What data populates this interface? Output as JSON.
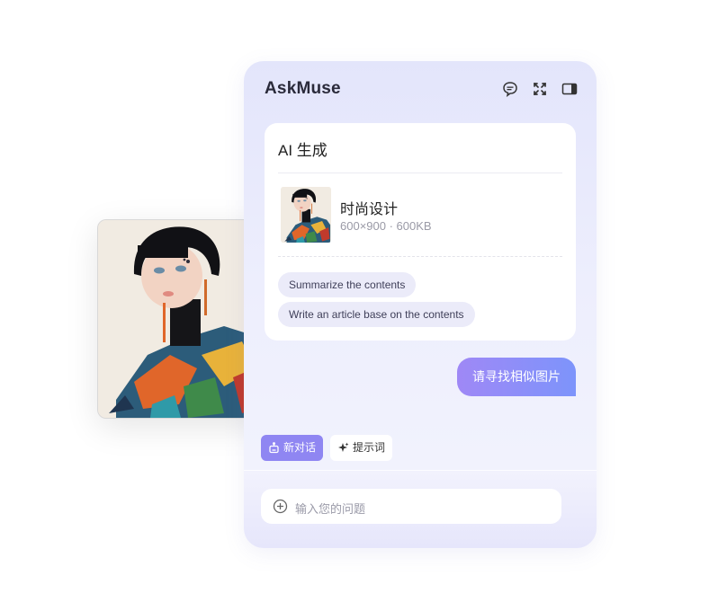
{
  "app": {
    "title": "AskMuse"
  },
  "header_icons": [
    "chat-bubble-icon",
    "fullscreen-icon",
    "sidebar-panel-icon"
  ],
  "card": {
    "title": "AI 生成",
    "file": {
      "name": "时尚设计",
      "meta": "600×900 · 600KB"
    },
    "suggestions": [
      "Summarize the contents",
      "Write an article base on the contents"
    ]
  },
  "chat": {
    "user_message": "请寻找相似图片"
  },
  "toolbar": {
    "new_chat": "新对话",
    "prompts": "提示词"
  },
  "input": {
    "placeholder": "输入您的问题"
  },
  "colors": {
    "accent": "#8f86f2",
    "bubble_gradient": [
      "#9f88f6",
      "#7d94fb"
    ],
    "panel_bg": "#e3e5fb",
    "add_badge": "#27a636"
  }
}
